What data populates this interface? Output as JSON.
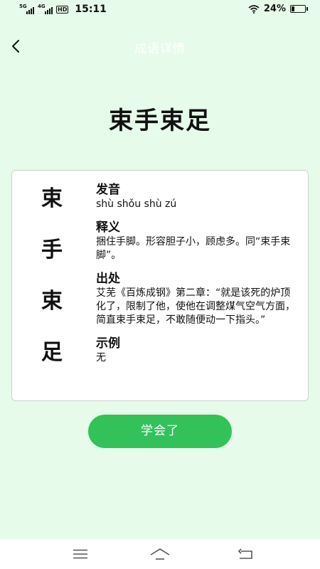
{
  "status_bar": {
    "signal1_tag": "5G",
    "signal2_tag": "4G",
    "hd_tag": "HD",
    "time": "15:11",
    "battery_percent": "24%",
    "battery_level": 0.24
  },
  "header": {
    "title": "成语详情",
    "back_icon": "chevron-left-icon"
  },
  "idiom": {
    "title": "束手束足",
    "chars": [
      "束",
      "手",
      "束",
      "足"
    ]
  },
  "details": {
    "pronunciation": {
      "label": "发音",
      "value": "shù shǒu shù zú"
    },
    "meaning": {
      "label": "释义",
      "value": "捆住手脚。形容胆子小，顾虑多。同“束手束脚”。"
    },
    "source": {
      "label": "出处",
      "value": "艾芜《百炼成钢》第二章：“就是该死的炉顶化了，限制了他，使他在调整煤气空气方面，简直束手束足，不敢随便动一下指头。”"
    },
    "example": {
      "label": "示例",
      "value": "无"
    }
  },
  "learned_button": {
    "label": "学会了"
  },
  "nav_bar": {
    "menu_icon": "menu-icon",
    "home_icon": "home-icon",
    "back_icon": "back-arrow-icon"
  },
  "colors": {
    "background": "#e6fbe9",
    "accent": "#33c25a",
    "card_border": "#c9d3cb"
  }
}
